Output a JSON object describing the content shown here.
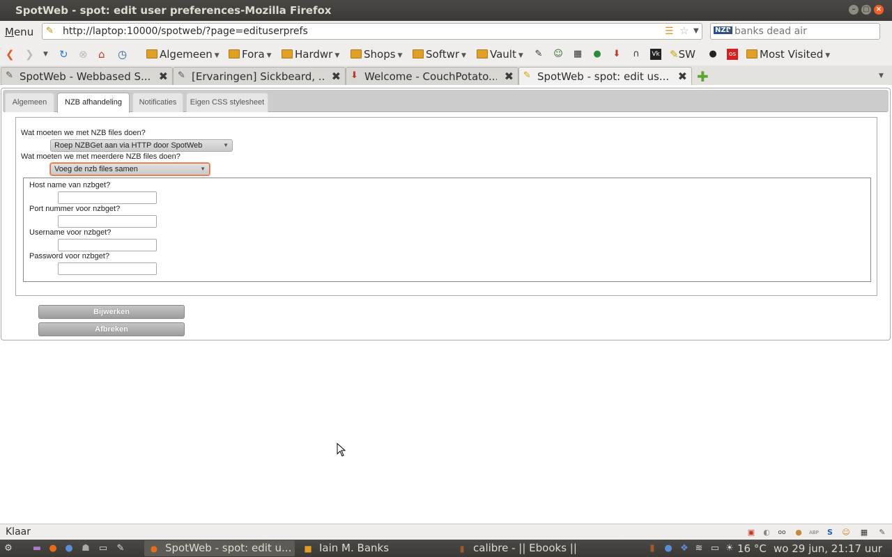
{
  "window": {
    "title": "SpotWeb - spot: edit user preferences-Mozilla Firefox"
  },
  "navbar": {
    "menu_label": "Menu",
    "url": "http://laptop:10000/spotweb/?page=edituserprefs",
    "search_engine": "NZB",
    "search_placeholder": "banks dead air"
  },
  "bookmarks": {
    "items": [
      {
        "label": "Algemeen",
        "folder": true
      },
      {
        "label": "Fora",
        "folder": true
      },
      {
        "label": "Hardwr",
        "folder": true
      },
      {
        "label": "Shops",
        "folder": true
      },
      {
        "label": "Softwr",
        "folder": true
      },
      {
        "label": "Vault",
        "folder": true
      }
    ],
    "sw_label": "SW",
    "most_visited_label": "Most Visited"
  },
  "tabs": [
    {
      "label": "SpotWeb - Webbased S...",
      "active": false
    },
    {
      "label": "[Ervaringen] Sickbeard, ...",
      "active": false
    },
    {
      "label": "Welcome - CouchPotato...",
      "active": false
    },
    {
      "label": "SpotWeb - spot: edit us...",
      "active": true
    }
  ],
  "page": {
    "tabs": [
      "Algemeen",
      "NZB afhandeling",
      "Notificaties",
      "Eigen CSS stylesheet"
    ],
    "active_tab": "NZB afhandeling",
    "q1_label": "Wat moeten we met NZB files doen?",
    "q1_value": "Roep NZBGet aan via HTTP door SpotWeb",
    "q2_label": "Wat moeten we met meerdere NZB files doen?",
    "q2_value": "Voeg de nzb files samen",
    "host_label": "Host name van nzbget?",
    "port_label": "Port nummer voor nzbget?",
    "username_label": "Username voor nzbget?",
    "password_label": "Password voor nzbget?",
    "submit_label": "Bijwerken",
    "cancel_label": "Afbreken"
  },
  "statusbar": {
    "text": "Klaar"
  },
  "taskbar": {
    "tasks": [
      {
        "label": "SpotWeb - spot: edit u...",
        "active": true
      },
      {
        "label": "Iain M. Banks",
        "active": false
      },
      {
        "label": "calibre - || Ebooks ||",
        "active": false
      }
    ],
    "temperature": "16 °C",
    "clock": "wo 29 jun, 21:17 uur"
  },
  "colors": {
    "accent_orange": "#f15d22",
    "titlebar": "#3c3b37",
    "focus_border": "#e86b3a"
  }
}
